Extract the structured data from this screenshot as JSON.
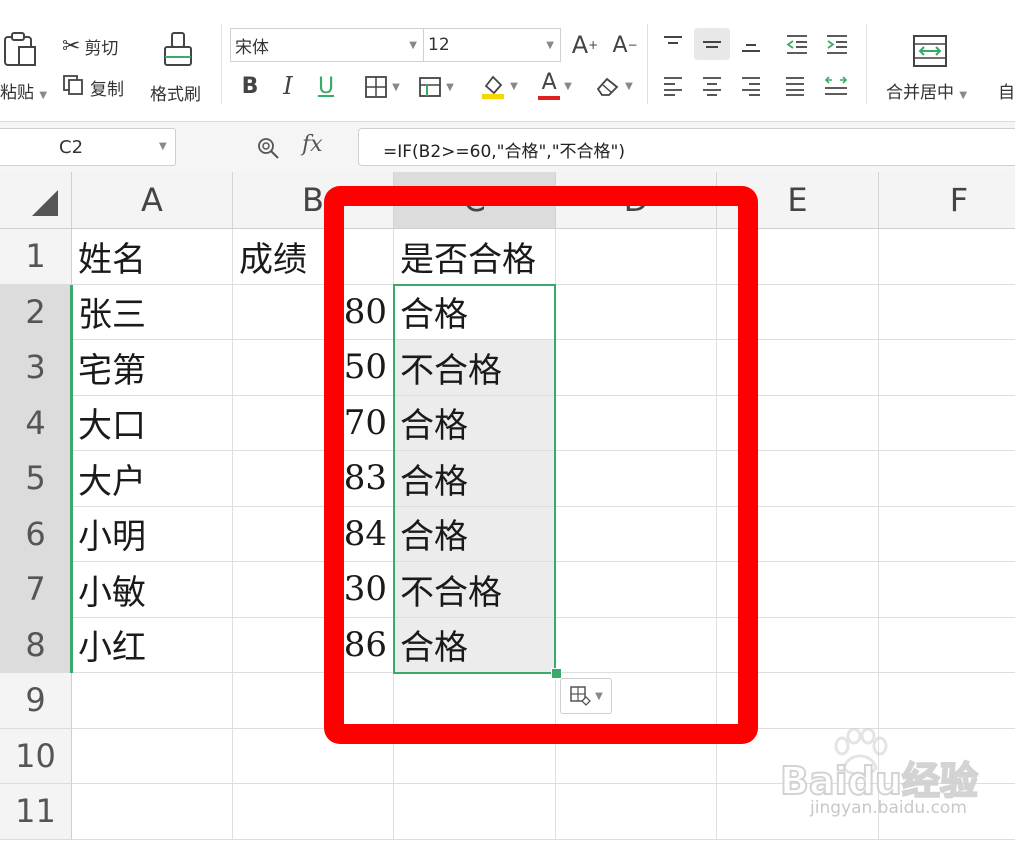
{
  "toolbar": {
    "paste_label": "粘贴",
    "cut_label": "剪切",
    "copy_label": "复制",
    "format_painter_label": "格式刷",
    "font_name": "宋体",
    "font_size": "12",
    "merge_center_label": "合并居中",
    "auto_wrap_label": "自",
    "bold": "B",
    "italic": "I",
    "underline": "U",
    "font_color_glyph": "A",
    "increase_font_glyph": "A",
    "decrease_font_glyph": "A"
  },
  "formula_bar": {
    "cell_ref": "C2",
    "fx_label": "fx",
    "formula": "=IF(B2>=60,\"合格\",\"不合格\")"
  },
  "columns": [
    "A",
    "B",
    "C",
    "D",
    "E",
    "F"
  ],
  "rows": [
    "1",
    "2",
    "3",
    "4",
    "5",
    "6",
    "7",
    "8",
    "9",
    "10",
    "11"
  ],
  "cells": {
    "A": [
      "姓名",
      "张三",
      "宅第",
      "大口",
      "大户",
      "小明",
      "小敏",
      "小红"
    ],
    "B": [
      "成绩",
      "80",
      "50",
      "70",
      "83",
      "84",
      "30",
      "86"
    ],
    "C": [
      "是否合格",
      "合格",
      "不合格",
      "合格",
      "合格",
      "合格",
      "不合格",
      "合格"
    ]
  },
  "colors": {
    "selection_border": "#3aaa6a",
    "highlight_box": "#ff0000",
    "font_color_bar": "#e02020",
    "fill_color_bar": "#f5d800"
  },
  "watermark": {
    "brand": "Baidu经验",
    "url": "jingyan.baidu.com"
  }
}
